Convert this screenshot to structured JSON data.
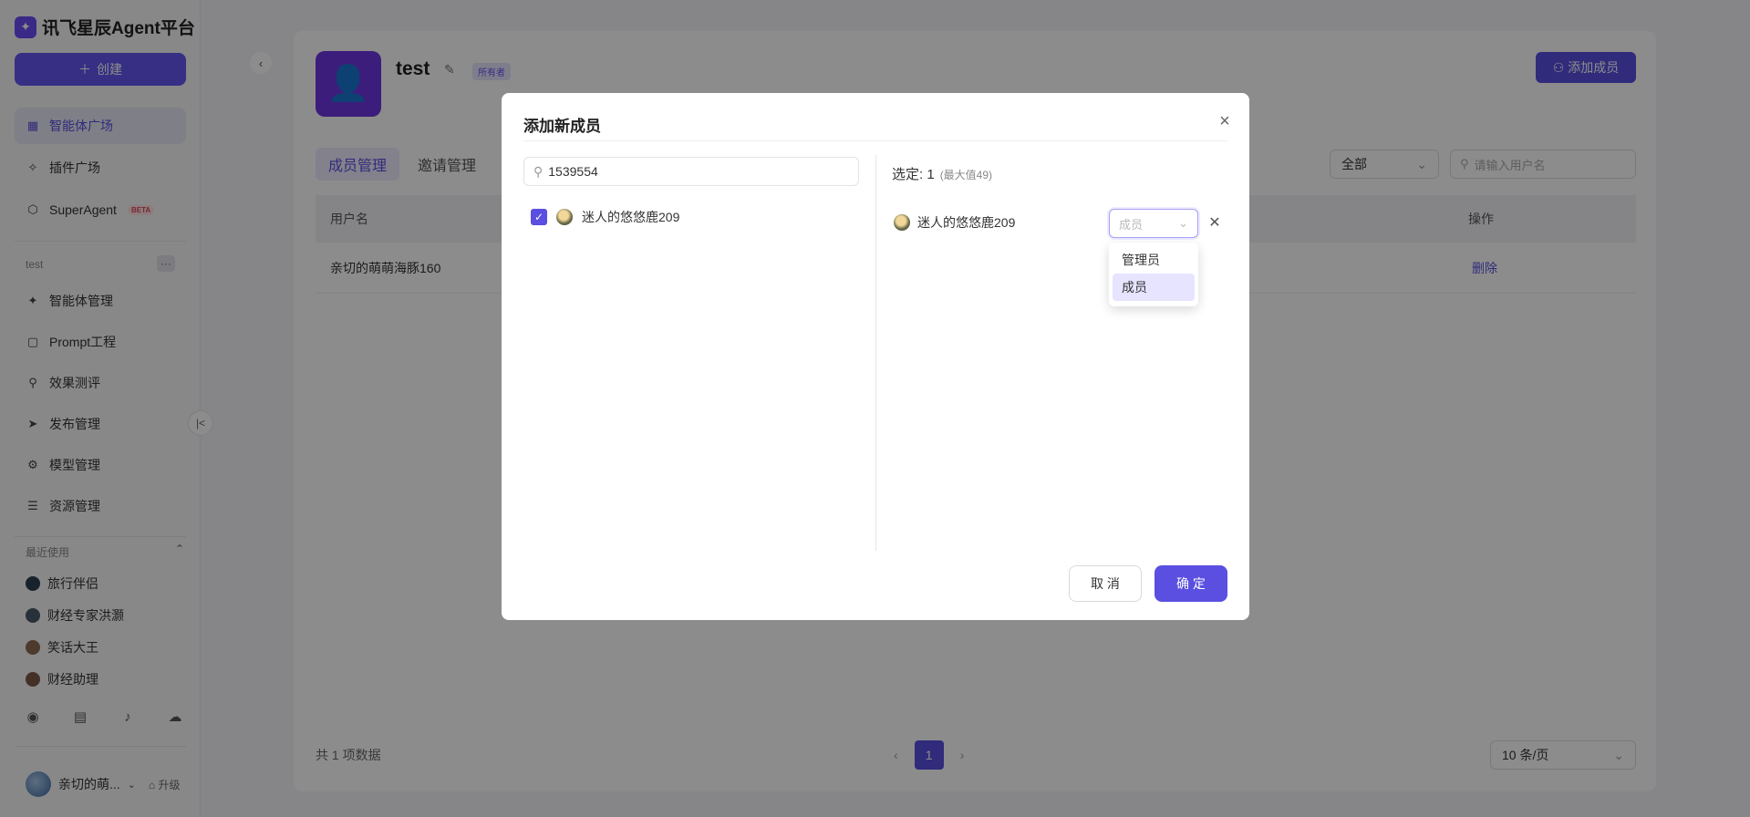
{
  "app": {
    "title": "讯飞星辰Agent平台",
    "create_label": "创建"
  },
  "sidebar": {
    "main_items": [
      {
        "label": "智能体广场",
        "icon": "grid-icon",
        "active": true
      },
      {
        "label": "插件广场",
        "icon": "puzzle-icon"
      },
      {
        "label": "SuperAgent",
        "icon": "cube-icon",
        "badge": "BETA"
      }
    ],
    "space": {
      "label": "test",
      "more": "···",
      "items": [
        {
          "label": "智能体管理",
          "icon": "sparkle-icon"
        },
        {
          "label": "Prompt工程",
          "icon": "chat-icon"
        },
        {
          "label": "效果测评",
          "icon": "test-icon"
        },
        {
          "label": "发布管理",
          "icon": "send-icon"
        },
        {
          "label": "模型管理",
          "icon": "model-icon"
        },
        {
          "label": "资源管理",
          "icon": "database-icon"
        }
      ]
    },
    "recent": {
      "label": "最近使用",
      "items": [
        {
          "label": "旅行伴侣"
        },
        {
          "label": "财经专家洪灏"
        },
        {
          "label": "笑话大王"
        },
        {
          "label": "财经助理"
        }
      ]
    },
    "footer_icons": [
      "github-icon",
      "document-icon",
      "bell-icon",
      "wechat-icon"
    ],
    "user": {
      "name": "亲切的萌...",
      "upgrade": "升级"
    }
  },
  "team": {
    "name": "test",
    "role_badge": "所有者",
    "add_member_label": "添加成员"
  },
  "tabs": [
    {
      "label": "成员管理",
      "active": true
    },
    {
      "label": "邀请管理"
    }
  ],
  "filter": {
    "role_value": "全部",
    "search_placeholder": "请输入用户名"
  },
  "table": {
    "headers": {
      "username": "用户名",
      "operation": "操作"
    },
    "rows": [
      {
        "username": "亲切的萌萌海豚160",
        "action": "删除"
      }
    ],
    "total": "共 1 项数据",
    "current_page": "1",
    "page_size": "10 条/页"
  },
  "modal": {
    "title": "添加新成员",
    "search_value": "1539554",
    "results": [
      {
        "name": "迷人的悠悠鹿209",
        "checked": true
      }
    ],
    "selected_label": "选定: 1",
    "selected_max": "(最大值49)",
    "selected": [
      {
        "name": "迷人的悠悠鹿209",
        "role": "成员"
      }
    ],
    "role_options": [
      {
        "label": "管理员"
      },
      {
        "label": "成员",
        "selected": true
      }
    ],
    "cancel_label": "取 消",
    "ok_label": "确 定"
  },
  "colors": {
    "primary": "#5a4fe0",
    "team_avatar": "#6d36e0"
  }
}
